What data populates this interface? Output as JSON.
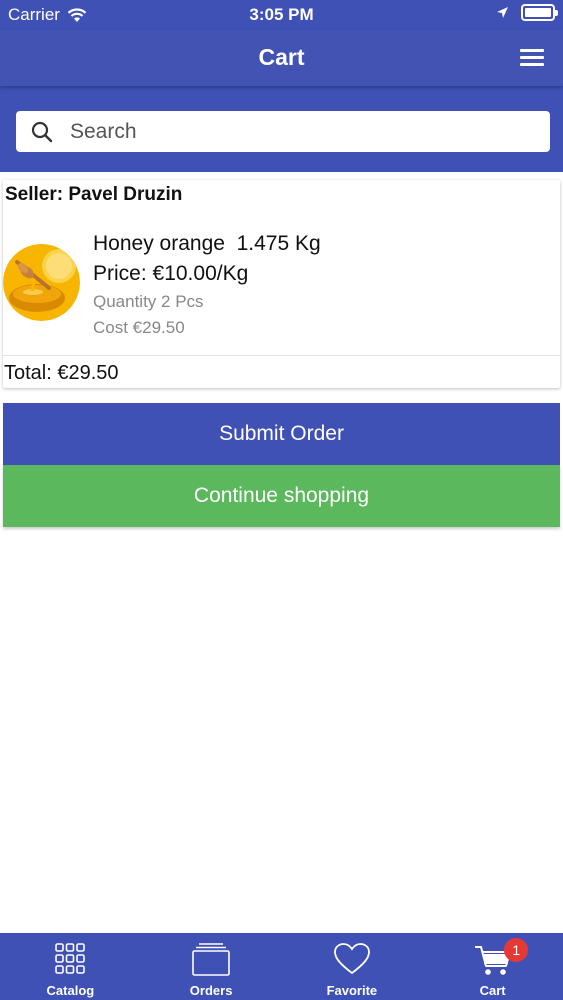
{
  "status_bar": {
    "carrier": "Carrier",
    "time": "3:05 PM"
  },
  "header": {
    "title": "Cart"
  },
  "search": {
    "placeholder": "Search"
  },
  "cart": {
    "seller_label": "Seller: Pavel Druzin",
    "items": [
      {
        "name": "Honey orange  1.475 Kg",
        "price": "Price: €10.00/Kg",
        "quantity": "Quantity 2 Pcs",
        "cost": "Cost €29.50",
        "image": "honey-jar-image"
      }
    ],
    "total": "Total: €29.50"
  },
  "actions": {
    "submit_label": "Submit Order",
    "continue_label": "Continue shopping"
  },
  "tabbar": {
    "tabs": [
      {
        "label": "Catalog",
        "icon": "grid-icon"
      },
      {
        "label": "Orders",
        "icon": "orders-icon"
      },
      {
        "label": "Favorite",
        "icon": "heart-icon"
      },
      {
        "label": "Cart",
        "icon": "cart-icon",
        "badge": "1"
      }
    ]
  },
  "colors": {
    "primary": "#3f51b5",
    "success": "#5cb85c",
    "badge": "#e53935"
  }
}
